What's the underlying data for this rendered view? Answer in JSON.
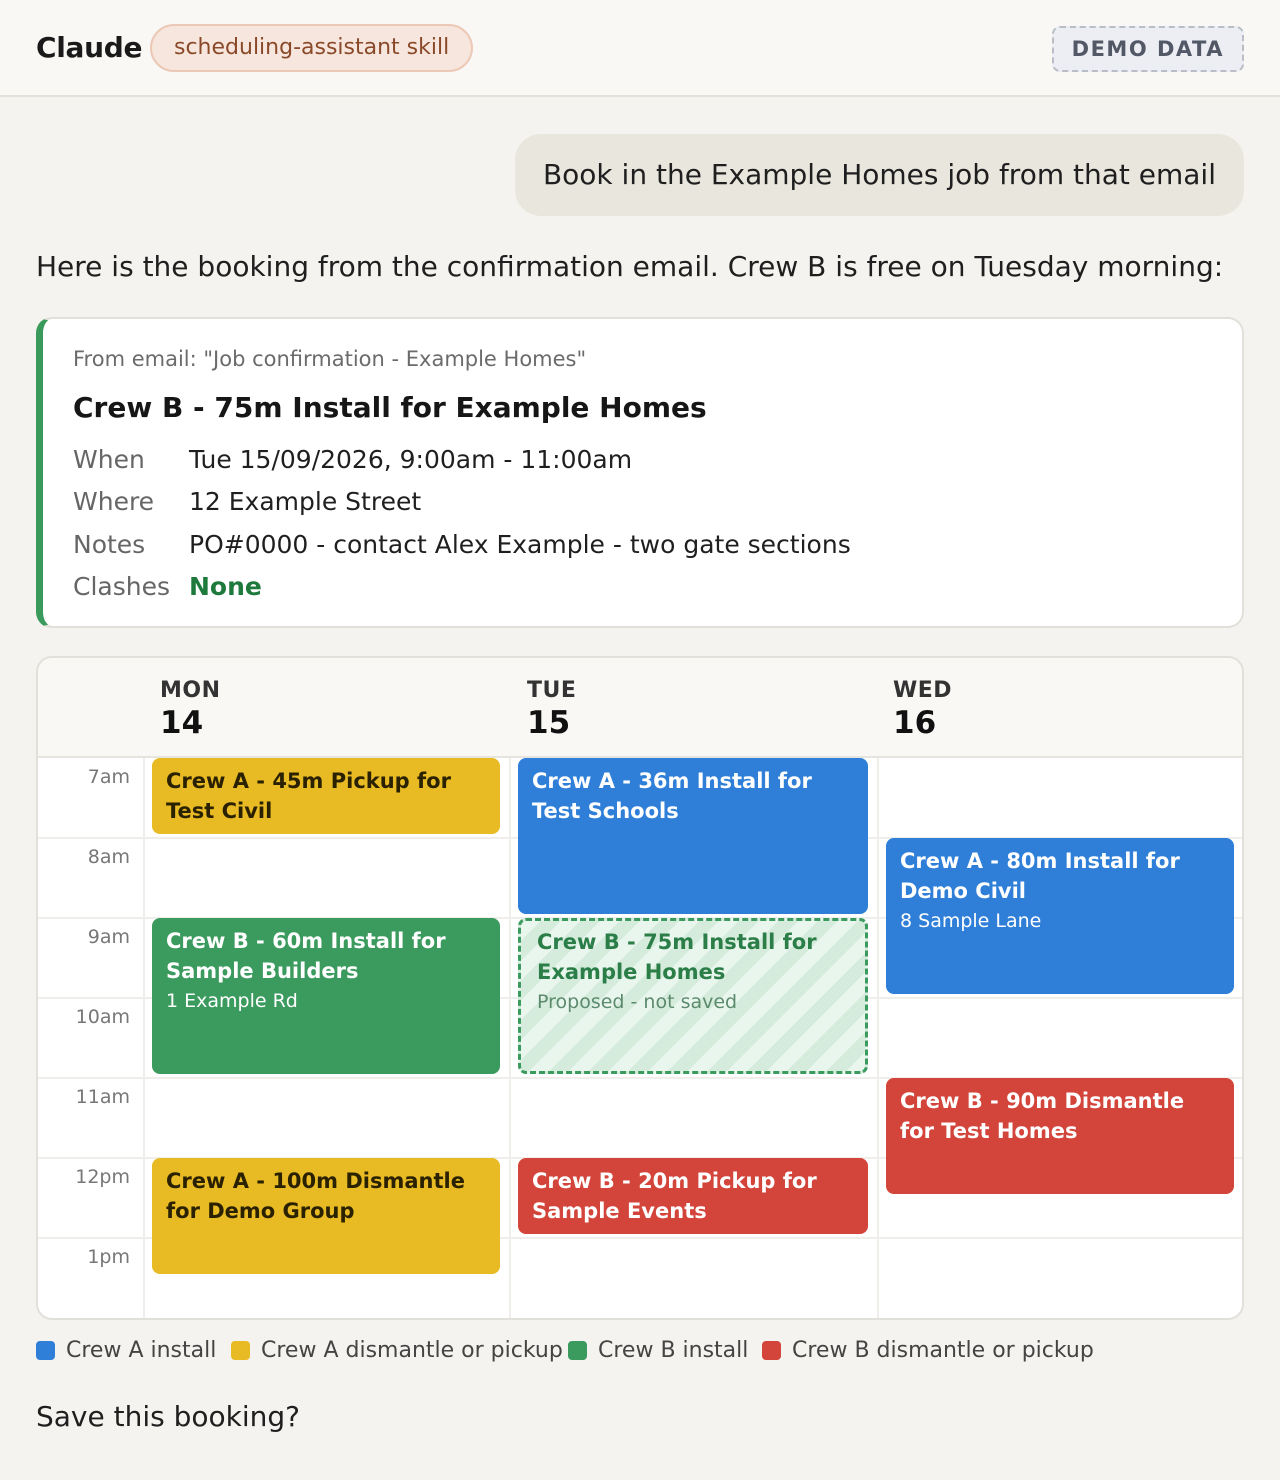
{
  "header": {
    "app_title": "Claude",
    "skill_label": "scheduling-assistant skill",
    "demo_badge": "DEMO DATA"
  },
  "user_message": "Book in the Example Homes job from that email",
  "assistant_intro": "Here is the booking from the confirmation email. Crew B is free on Tuesday morning:",
  "booking": {
    "source": "From email: \"Job confirmation - Example Homes\"",
    "title": "Crew B - 75m Install for Example Homes",
    "accent_color": "#3a9a5c",
    "details": [
      {
        "label": "When",
        "value": "Tue 15/09/2026, 9:00am - 11:00am"
      },
      {
        "label": "Where",
        "value": "12 Example Street"
      },
      {
        "label": "Notes",
        "value": "PO#0000 - contact Alex Example - two gate sections"
      },
      {
        "label": "Clashes",
        "value": "None"
      }
    ]
  },
  "calendar": {
    "days": [
      {
        "name": "MON",
        "num": "14"
      },
      {
        "name": "TUE",
        "num": "15"
      },
      {
        "name": "WED",
        "num": "16"
      }
    ],
    "hours": [
      "7am",
      "8am",
      "9am",
      "10am",
      "11am",
      "12pm",
      "1pm"
    ],
    "events": {
      "mon_pickup": {
        "title": "Crew A - 45m Pickup for Test Civil"
      },
      "mon_install": {
        "title": "Crew B - 60m Install for Sample Builders",
        "sub": "1 Example Rd"
      },
      "mon_dismantle": {
        "title": "Crew A - 100m Dismantle for Demo Group"
      },
      "tue_install": {
        "title": "Crew A - 36m Install for Test Schools"
      },
      "tue_proposed": {
        "title": "Crew B - 75m Install for Example Homes",
        "sub": "Proposed - not saved"
      },
      "tue_pickup": {
        "title": "Crew B - 20m Pickup for Sample Events"
      },
      "wed_install": {
        "title": "Crew A - 80m Install for Demo Civil",
        "sub": "8 Sample Lane"
      },
      "wed_dismantle": {
        "title": "Crew B - 90m Dismantle for Test Homes"
      }
    }
  },
  "legend": [
    {
      "label": "Crew A install",
      "color": "#2f7fd8"
    },
    {
      "label": "Crew A dismantle or pickup",
      "color": "#e8ba23"
    },
    {
      "label": "Crew B install",
      "color": "#3b9b5e"
    },
    {
      "label": "Crew B dismantle or pickup",
      "color": "#d3443b"
    }
  ],
  "closing_question": "Save this booking?"
}
